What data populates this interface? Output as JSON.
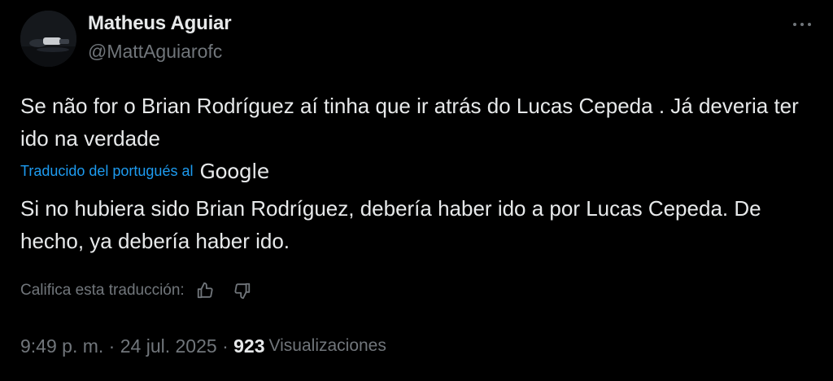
{
  "author": {
    "name": "Matheus Aguiar",
    "handle": "@MattAguiarofc",
    "avatar_icon": "profile-photo"
  },
  "more_icon": "more-horizontal-icon",
  "tweet": {
    "original_text": "Se não for o Brian Rodríguez aí tinha que ir atrás do Lucas Cepeda . Já deveria ter ido na verdade",
    "translated_label": "Traducido del portugués al",
    "translator_brand": "Google",
    "translated_text": "Si no hubiera sido Brian Rodríguez, debería haber ido a por Lucas Cepeda. De hecho, ya debería haber ido.",
    "rate_label": "Califica esta traducción:",
    "rate_icons": [
      "thumbs-up-icon",
      "thumbs-down-icon"
    ]
  },
  "meta": {
    "time": "9:49 p. m.",
    "separator": "·",
    "date": "24 jul. 2025",
    "views_count": "923",
    "views_label": "Visualizaciones"
  },
  "colors": {
    "background": "#000000",
    "primary_text": "#e7e9ea",
    "secondary_text": "#71767b",
    "link": "#1d9bf0"
  }
}
